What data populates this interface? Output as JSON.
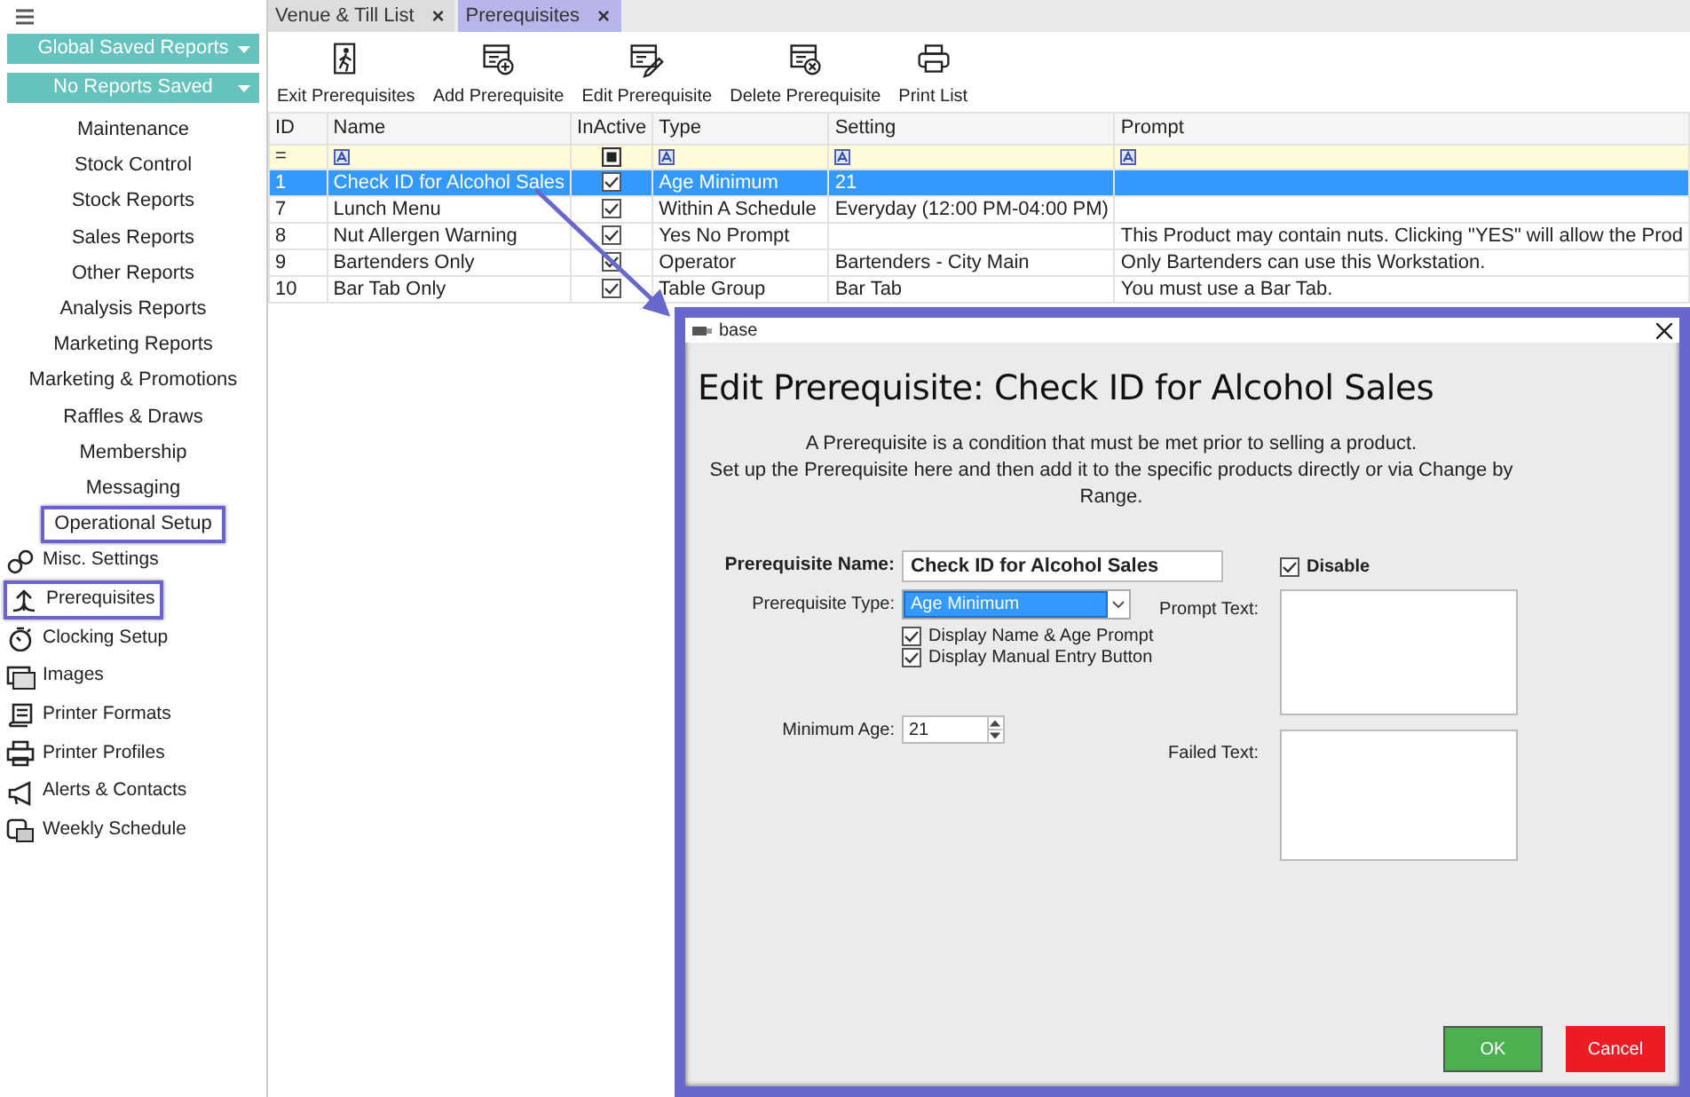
{
  "sidebar": {
    "dropdowns": [
      {
        "label": "Global Saved Reports"
      },
      {
        "label": "No Reports Saved"
      }
    ],
    "sections": [
      {
        "label": "Maintenance",
        "highlighted": false
      },
      {
        "label": "Stock Control",
        "highlighted": false
      },
      {
        "label": "Stock Reports",
        "highlighted": false
      },
      {
        "label": "Sales Reports",
        "highlighted": false
      },
      {
        "label": "Other Reports",
        "highlighted": false
      },
      {
        "label": "Analysis Reports",
        "highlighted": false
      },
      {
        "label": "Marketing Reports",
        "highlighted": false
      },
      {
        "label": "Marketing & Promotions",
        "highlighted": false
      },
      {
        "label": "Raffles & Draws",
        "highlighted": false
      },
      {
        "label": "Membership",
        "highlighted": false
      },
      {
        "label": "Messaging",
        "highlighted": false
      },
      {
        "label": "Operational Setup",
        "highlighted": true
      }
    ],
    "items": [
      {
        "label": "Misc. Settings",
        "highlighted": false
      },
      {
        "label": "Prerequisites",
        "highlighted": true
      },
      {
        "label": "Clocking Setup",
        "highlighted": false
      },
      {
        "label": "Images",
        "highlighted": false
      },
      {
        "label": "Printer Formats",
        "highlighted": false
      },
      {
        "label": "Printer Profiles",
        "highlighted": false
      },
      {
        "label": "Alerts & Contacts",
        "highlighted": false
      },
      {
        "label": "Weekly Schedule",
        "highlighted": false
      }
    ]
  },
  "tabs": [
    {
      "label": "Venue & Till List",
      "close": "×",
      "selected": false
    },
    {
      "label": "Prerequisites",
      "close": "×",
      "selected": true
    }
  ],
  "toolbar": [
    {
      "label": "Exit Prerequisites"
    },
    {
      "label": "Add Prerequisite"
    },
    {
      "label": "Edit Prerequisite"
    },
    {
      "label": "Delete Prerequisite"
    },
    {
      "label": "Print List"
    }
  ],
  "table": {
    "columns": [
      "ID",
      "Name",
      "InActive",
      "Type",
      "Setting",
      "Prompt"
    ],
    "filter_operator": "=",
    "inactive_filter_checked": true,
    "rows": [
      {
        "id": "1",
        "name": "Check ID for Alcohol Sales",
        "inactive": true,
        "type": "Age Minimum",
        "setting": "21",
        "prompt": "",
        "selected": true
      },
      {
        "id": "7",
        "name": "Lunch Menu",
        "inactive": true,
        "type": "Within A Schedule",
        "setting": "Everyday (12:00 PM-04:00 PM)",
        "prompt": "",
        "selected": false
      },
      {
        "id": "8",
        "name": "Nut Allergen Warning",
        "inactive": true,
        "type": "Yes No Prompt",
        "setting": "",
        "prompt": "This Product may contain nuts. Clicking \"YES\" will allow the Prod",
        "selected": false
      },
      {
        "id": "9",
        "name": "Bartenders Only",
        "inactive": true,
        "type": "Operator",
        "setting": "Bartenders - City Main",
        "prompt": "Only Bartenders can use this Workstation.",
        "selected": false
      },
      {
        "id": "10",
        "name": "Bar Tab Only",
        "inactive": true,
        "type": "Table Group",
        "setting": "Bar Tab",
        "prompt": "You must use a Bar Tab.",
        "selected": false
      }
    ]
  },
  "dialog": {
    "title": "base",
    "heading": "Edit Prerequisite: Check ID for Alcohol Sales",
    "description": [
      "A Prerequisite is a condition that must be met prior to selling a product.",
      "Set up the Prerequisite here and then add it to the specific products directly or via Change by Range."
    ],
    "name_label": "Prerequisite Name:",
    "name_value": "Check ID for Alcohol Sales",
    "type_label": "Prerequisite Type:",
    "type_value": "Age Minimum",
    "options": [
      {
        "label": "Display Name & Age Prompt",
        "checked": true
      },
      {
        "label": "Display Manual Entry Button",
        "checked": true
      }
    ],
    "min_age_label": "Minimum Age:",
    "min_age_value": "21",
    "disable": {
      "label": "Disable",
      "checked": true
    },
    "prompt_label": "Prompt Text:",
    "failed_label": "Failed Text:",
    "buttons": [
      {
        "label": "OK",
        "kind": "ok"
      },
      {
        "label": "Cancel",
        "kind": "cancel"
      }
    ]
  }
}
